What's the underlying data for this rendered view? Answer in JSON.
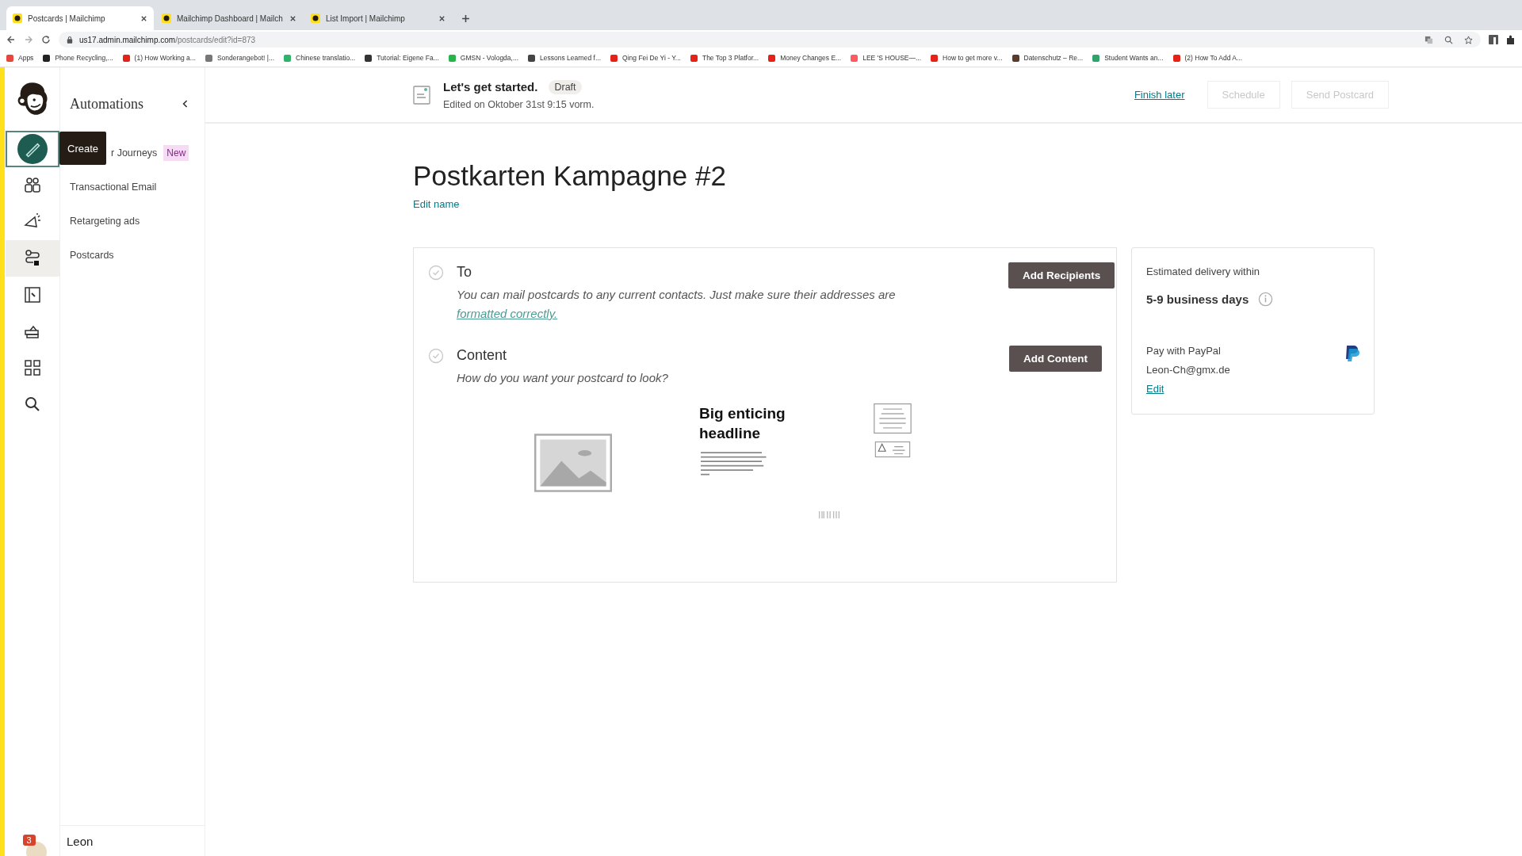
{
  "browser": {
    "tabs": [
      {
        "title": "Postcards | Mailchimp",
        "selected": true
      },
      {
        "title": "Mailchimp Dashboard | Mailch",
        "selected": false
      },
      {
        "title": "List Import | Mailchimp",
        "selected": false
      }
    ],
    "url_host": "us17.admin.mailchimp.com",
    "url_path": "/postcards/edit?id=873",
    "bookmarks": [
      {
        "label": "Apps",
        "color": "#e8453c"
      },
      {
        "label": "Phone Recycling,...",
        "color": "#222222"
      },
      {
        "label": "(1) How Working a...",
        "color": "#e62117"
      },
      {
        "label": "Sonderangebot! |...",
        "color": "#777777"
      },
      {
        "label": "Chinese translatio...",
        "color": "#2fb36b"
      },
      {
        "label": "Tutorial: Eigene Fa...",
        "color": "#333333"
      },
      {
        "label": "GMSN - Vologda,...",
        "color": "#28b44a"
      },
      {
        "label": "Lessons Learned f...",
        "color": "#444444"
      },
      {
        "label": "Qing Fei De Yi - Y...",
        "color": "#e62117"
      },
      {
        "label": "The Top 3 Platfor...",
        "color": "#e62117"
      },
      {
        "label": "Money Changes E...",
        "color": "#e62117"
      },
      {
        "label": "LEE 'S HOUSE—...",
        "color": "#ff5a5f"
      },
      {
        "label": "How to get more v...",
        "color": "#e62117"
      },
      {
        "label": "Datenschutz – Re...",
        "color": "#5a3a2a"
      },
      {
        "label": "Student Wants an...",
        "color": "#2fa36b"
      },
      {
        "label": "(2) How To Add A...",
        "color": "#e62117"
      }
    ]
  },
  "rail": [
    {
      "kind": "create",
      "selected": false
    },
    {
      "kind": "audience",
      "selected": false
    },
    {
      "kind": "campaigns",
      "selected": false
    },
    {
      "kind": "automations",
      "selected": true
    },
    {
      "kind": "website",
      "selected": false
    },
    {
      "kind": "content",
      "selected": false
    },
    {
      "kind": "integrations",
      "selected": false
    },
    {
      "kind": "search",
      "selected": false
    }
  ],
  "tooltip": "Create",
  "notifications": "3",
  "user": "Leon",
  "sidebar": {
    "title": "Automations",
    "items": [
      {
        "label": "r Journeys",
        "badge": "New"
      },
      {
        "label": "Transactional Email"
      },
      {
        "label": "Retargeting ads"
      },
      {
        "label": "Postcards"
      }
    ]
  },
  "header": {
    "title": "Let's get started.",
    "status": "Draft",
    "edited": "Edited on Oktober 31st 9:15 vorm.",
    "finish_later": "Finish later",
    "schedule": "Schedule",
    "send": "Send Postcard"
  },
  "campaign": {
    "name": "Postkarten Kampagne #2",
    "edit_name": "Edit name"
  },
  "steps": [
    {
      "title": "To",
      "description": "You can mail postcards to any current contacts. Just make sure their addresses are",
      "link": "formatted correctly.",
      "button": "Add Recipients"
    },
    {
      "title": "Content",
      "description": "How do you want your postcard to look?",
      "button": "Add Content"
    }
  ],
  "preview": {
    "headline": "Big enticing headline"
  },
  "delivery": {
    "label": "Estimated delivery within",
    "days": "5-9 business days",
    "payment": "Pay with PayPal",
    "email": "Leon-Ch@gmx.de",
    "edit": "Edit"
  }
}
